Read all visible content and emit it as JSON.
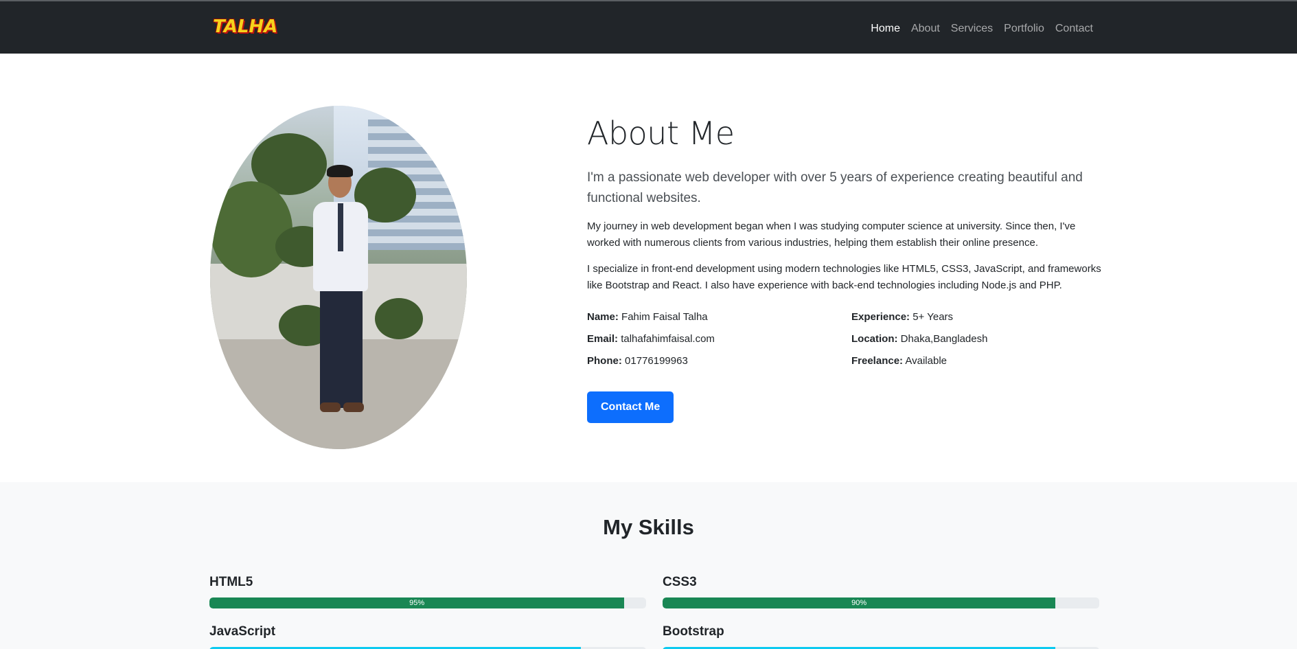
{
  "nav": {
    "logo": "TALHA",
    "links": [
      {
        "label": "Home",
        "active": true
      },
      {
        "label": "About",
        "active": false
      },
      {
        "label": "Services",
        "active": false
      },
      {
        "label": "Portfolio",
        "active": false
      },
      {
        "label": "Contact",
        "active": false
      }
    ]
  },
  "about": {
    "title": "About Me",
    "lead": "I'm a passionate web developer with over 5 years of experience creating beautiful and functional websites.",
    "para1": "My journey in web development began when I was studying computer science at university. Since then, I've worked with numerous clients from various industries, helping them establish their online presence.",
    "para2": "I specialize in front-end development using modern technologies like HTML5, CSS3, JavaScript, and frameworks like Bootstrap and React. I also have experience with back-end technologies including Node.js and PHP.",
    "info": {
      "name_label": "Name:",
      "name_value": "Fahim Faisal Talha",
      "experience_label": "Experience:",
      "experience_value": "5+ Years",
      "email_label": "Email:",
      "email_value": "talhafahimfaisal.com",
      "location_label": "Location:",
      "location_value": "Dhaka,Bangladesh",
      "phone_label": "Phone:",
      "phone_value": "01776199963",
      "freelance_label": "Freelance:",
      "freelance_value": "Available"
    },
    "contact_button": "Contact Me"
  },
  "skills": {
    "title": "My Skills",
    "items": [
      {
        "name": "HTML5",
        "percent": 95,
        "label": "95%",
        "color": "#198754"
      },
      {
        "name": "CSS3",
        "percent": 90,
        "label": "90%",
        "color": "#198754"
      },
      {
        "name": "JavaScript",
        "percent": 85,
        "label": "",
        "color": "#0dcaf0"
      },
      {
        "name": "Bootstrap",
        "percent": 90,
        "label": "",
        "color": "#0dcaf0"
      }
    ]
  },
  "colors": {
    "navbar": "#212529",
    "primary": "#0d6efd",
    "success": "#198754",
    "info": "#0dcaf0"
  }
}
